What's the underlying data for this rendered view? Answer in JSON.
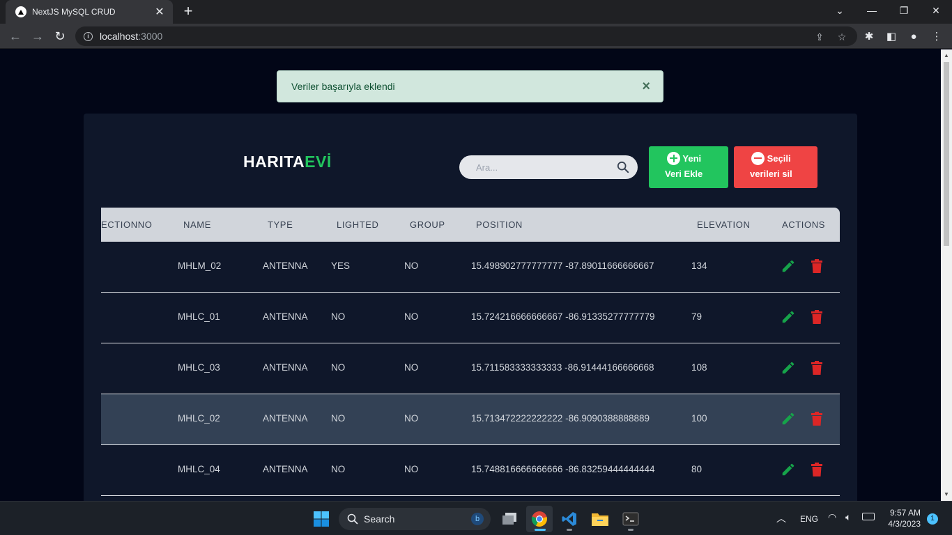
{
  "browser": {
    "tab_title": "NextJS MySQL CRUD",
    "url_host": "localhost",
    "url_port": ":3000"
  },
  "toast": {
    "message": "Veriler başarıyla eklendi",
    "close": "×"
  },
  "header": {
    "logo_part1": "HARITA",
    "logo_part2": "EVİ",
    "search_placeholder": "Ara...",
    "add_button_line1": "Yeni",
    "add_button_line2": "Veri Ekle",
    "delete_button_line1": "Seçili",
    "delete_button_line2": "verileri sil"
  },
  "table": {
    "columns": [
      "ECTIONNO",
      "NAME",
      "TYPE",
      "LIGHTED",
      "GROUP",
      "POSITION",
      "ELEVATION",
      "ACTIONS"
    ],
    "rows": [
      {
        "name": "MHLM_02",
        "type": "ANTENNA",
        "lighted": "YES",
        "group": "NO",
        "position": "15.498902777777777 -87.89011666666667",
        "elevation": "134",
        "highlighted": false
      },
      {
        "name": "MHLC_01",
        "type": "ANTENNA",
        "lighted": "NO",
        "group": "NO",
        "position": "15.724216666666667 -86.91335277777779",
        "elevation": "79",
        "highlighted": false
      },
      {
        "name": "MHLC_03",
        "type": "ANTENNA",
        "lighted": "NO",
        "group": "NO",
        "position": "15.711583333333333 -86.91444166666668",
        "elevation": "108",
        "highlighted": false
      },
      {
        "name": "MHLC_02",
        "type": "ANTENNA",
        "lighted": "NO",
        "group": "NO",
        "position": "15.713472222222222 -86.9090388888889",
        "elevation": "100",
        "highlighted": true
      },
      {
        "name": "MHLC_04",
        "type": "ANTENNA",
        "lighted": "NO",
        "group": "NO",
        "position": "15.748816666666666 -86.83259444444444",
        "elevation": "80",
        "highlighted": false
      }
    ]
  },
  "taskbar": {
    "search_label": "Search",
    "language": "ENG",
    "time": "9:57 AM",
    "date": "4/3/2023",
    "notification_count": "1"
  },
  "colors": {
    "accent_green": "#22c55e",
    "accent_red": "#ef4444",
    "toast_bg": "#d1e7dd",
    "page_bg": "#020617",
    "card_bg": "#0f172a"
  }
}
